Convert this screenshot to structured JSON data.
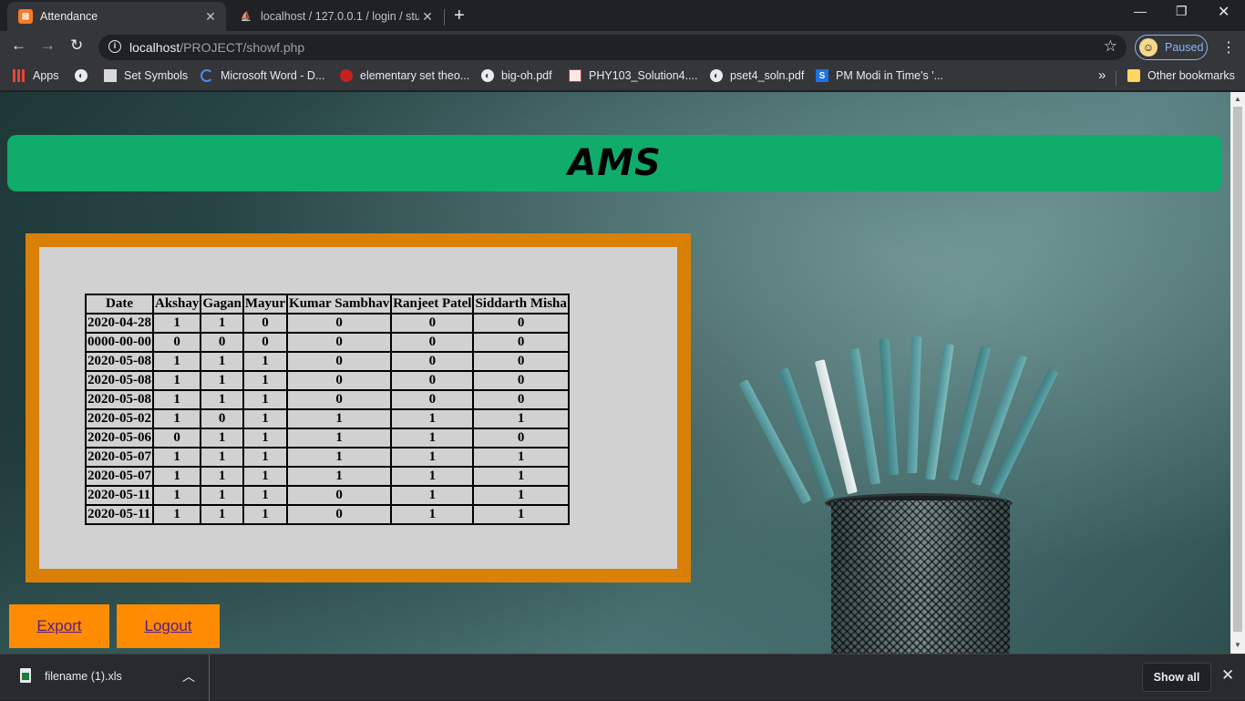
{
  "browser": {
    "tabs": [
      {
        "title": "Attendance",
        "favicon": "xampp-icon",
        "active": true
      },
      {
        "title": "localhost / 127.0.0.1 / login / stud",
        "favicon": "phpmyadmin-icon",
        "active": false
      }
    ],
    "url_host": "localhost",
    "url_path": "/PROJECT/showf.php",
    "profile_status": "Paused",
    "bookmarks": [
      {
        "label": "Apps",
        "icon": "apps-icon"
      },
      {
        "label": "",
        "icon": "globe-icon"
      },
      {
        "label": "Set Symbols",
        "icon": "image-icon"
      },
      {
        "label": "Microsoft Word - D...",
        "icon": "loading-icon"
      },
      {
        "label": "elementary set theo...",
        "icon": "red-gear-icon"
      },
      {
        "label": "big-oh.pdf",
        "icon": "globe-icon"
      },
      {
        "label": "PHY103_Solution4....",
        "icon": "pdf-icon"
      },
      {
        "label": "pset4_soln.pdf",
        "icon": "globe-icon"
      },
      {
        "label": "PM Modi in Time's '...",
        "icon": "scribd-icon"
      }
    ],
    "bookmarks_overflow": "»",
    "other_bookmarks": "Other bookmarks"
  },
  "page": {
    "heading": "AMS",
    "table": {
      "headers": [
        "Date",
        "Akshay",
        "Gagan",
        "Mayur",
        "Kumar Sambhav",
        "Ranjeet Patel",
        "Siddarth Misha"
      ],
      "rows": [
        [
          "2020-04-28",
          "1",
          "1",
          "0",
          "0",
          "0",
          "0"
        ],
        [
          "0000-00-00",
          "0",
          "0",
          "0",
          "0",
          "0",
          "0"
        ],
        [
          "2020-05-08",
          "1",
          "1",
          "1",
          "0",
          "0",
          "0"
        ],
        [
          "2020-05-08",
          "1",
          "1",
          "1",
          "0",
          "0",
          "0"
        ],
        [
          "2020-05-08",
          "1",
          "1",
          "1",
          "0",
          "0",
          "0"
        ],
        [
          "2020-05-02",
          "1",
          "0",
          "1",
          "1",
          "1",
          "1"
        ],
        [
          "2020-05-06",
          "0",
          "1",
          "1",
          "1",
          "1",
          "0"
        ],
        [
          "2020-05-07",
          "1",
          "1",
          "1",
          "1",
          "1",
          "1"
        ],
        [
          "2020-05-07",
          "1",
          "1",
          "1",
          "1",
          "1",
          "1"
        ],
        [
          "2020-05-11",
          "1",
          "1",
          "1",
          "0",
          "1",
          "1"
        ],
        [
          "2020-05-11",
          "1",
          "1",
          "1",
          "0",
          "1",
          "1"
        ]
      ]
    },
    "buttons": {
      "export": "Export",
      "logout": "Logout"
    }
  },
  "downloads": {
    "file": "filename (1).xls",
    "show_all": "Show all"
  },
  "colors": {
    "header_bg": "#10ac6c",
    "panel_border": "#d88008",
    "panel_bg": "#d1d1d1",
    "button_bg": "#ff8c00",
    "link": "#551a8b"
  }
}
